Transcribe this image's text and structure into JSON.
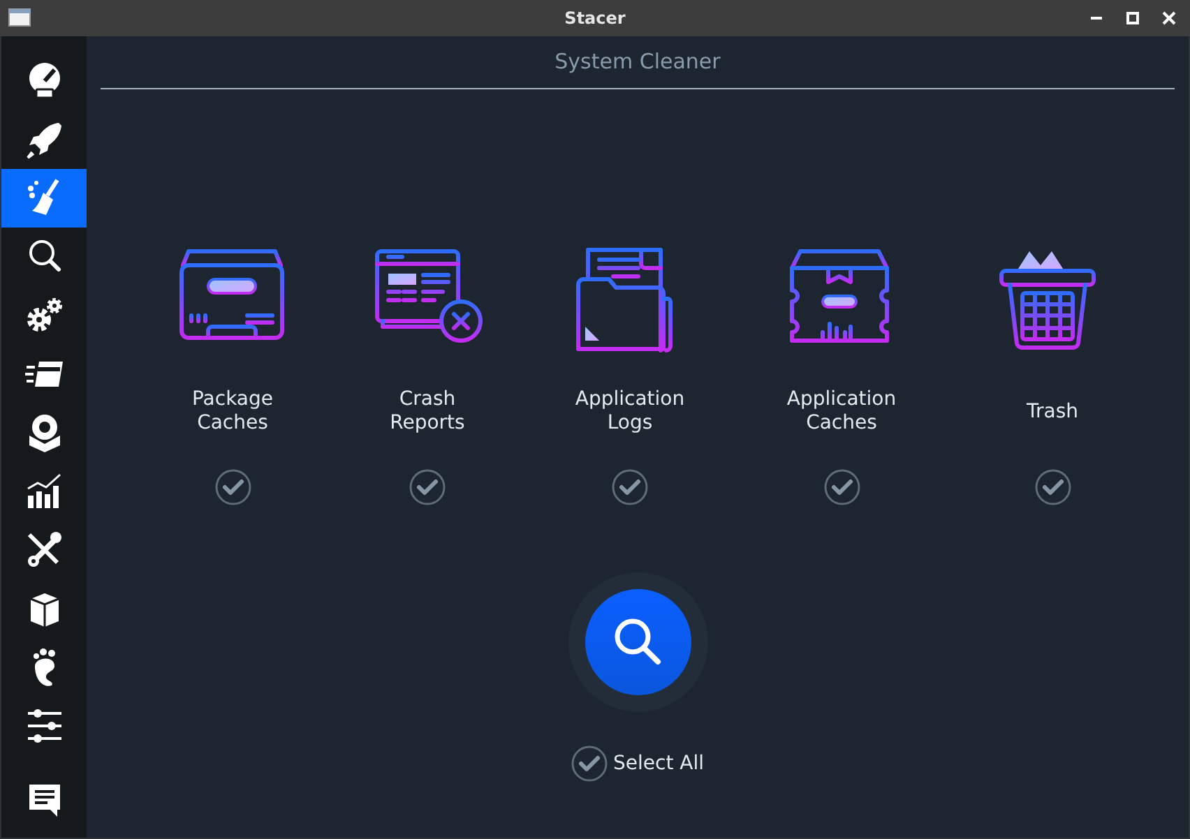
{
  "window": {
    "title": "Stacer"
  },
  "sidebar": {
    "items": [
      {
        "selected": false
      },
      {
        "selected": false
      },
      {
        "selected": true
      },
      {
        "selected": false
      },
      {
        "selected": false
      },
      {
        "selected": false
      },
      {
        "selected": false
      },
      {
        "selected": false
      },
      {
        "selected": false
      },
      {
        "selected": false
      },
      {
        "selected": false
      },
      {
        "selected": false
      },
      {
        "selected": false
      }
    ]
  },
  "page": {
    "title": "System Cleaner"
  },
  "categories": [
    {
      "label": "Package\nCaches",
      "checked": true
    },
    {
      "label": "Crash\nReports",
      "checked": true
    },
    {
      "label": "Application\nLogs",
      "checked": true
    },
    {
      "label": "Application\nCaches",
      "checked": true
    },
    {
      "label": "Trash",
      "checked": true
    }
  ],
  "select_all": {
    "label": "Select All",
    "checked": true
  }
}
